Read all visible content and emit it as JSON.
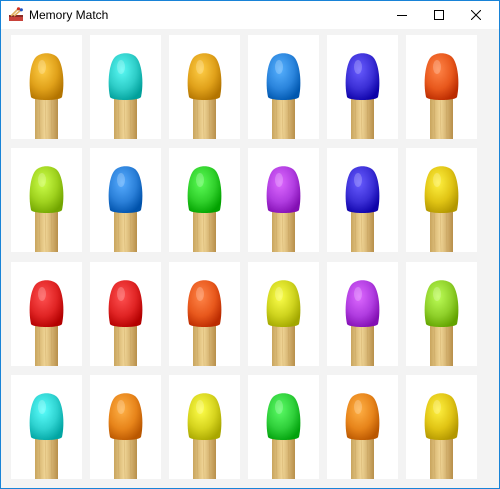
{
  "window": {
    "title": "Memory Match"
  },
  "icons": {
    "app": "matchbox-icon",
    "minimize": "minimize-icon",
    "maximize": "maximize-icon",
    "close": "close-icon"
  },
  "board": {
    "rows": 4,
    "columns": 6,
    "cards": [
      {
        "color": "#e0a11a",
        "depicts": "matchstick"
      },
      {
        "color": "#2ecdc8",
        "depicts": "matchstick"
      },
      {
        "color": "#e0a11a",
        "depicts": "matchstick"
      },
      {
        "color": "#2a84dc",
        "depicts": "matchstick"
      },
      {
        "color": "#3b2fd6",
        "depicts": "matchstick"
      },
      {
        "color": "#e8581c",
        "depicts": "matchstick"
      },
      {
        "color": "#9fd21e",
        "depicts": "matchstick"
      },
      {
        "color": "#2a7fd8",
        "depicts": "matchstick"
      },
      {
        "color": "#2fcf2a",
        "depicts": "matchstick"
      },
      {
        "color": "#b03ce0",
        "depicts": "matchstick"
      },
      {
        "color": "#3b2fd6",
        "depicts": "matchstick"
      },
      {
        "color": "#e0c414",
        "depicts": "matchstick"
      },
      {
        "color": "#e02424",
        "depicts": "matchstick"
      },
      {
        "color": "#e02424",
        "depicts": "matchstick"
      },
      {
        "color": "#e8581c",
        "depicts": "matchstick"
      },
      {
        "color": "#cfd41e",
        "depicts": "matchstick"
      },
      {
        "color": "#b03ce0",
        "depicts": "matchstick"
      },
      {
        "color": "#8fd02a",
        "depicts": "matchstick"
      },
      {
        "color": "#2ed2d0",
        "depicts": "matchstick"
      },
      {
        "color": "#e7841a",
        "depicts": "matchstick"
      },
      {
        "color": "#d6d41e",
        "depicts": "matchstick"
      },
      {
        "color": "#2fcf3a",
        "depicts": "matchstick"
      },
      {
        "color": "#e7841a",
        "depicts": "matchstick"
      },
      {
        "color": "#e0c414",
        "depicts": "matchstick"
      }
    ]
  }
}
